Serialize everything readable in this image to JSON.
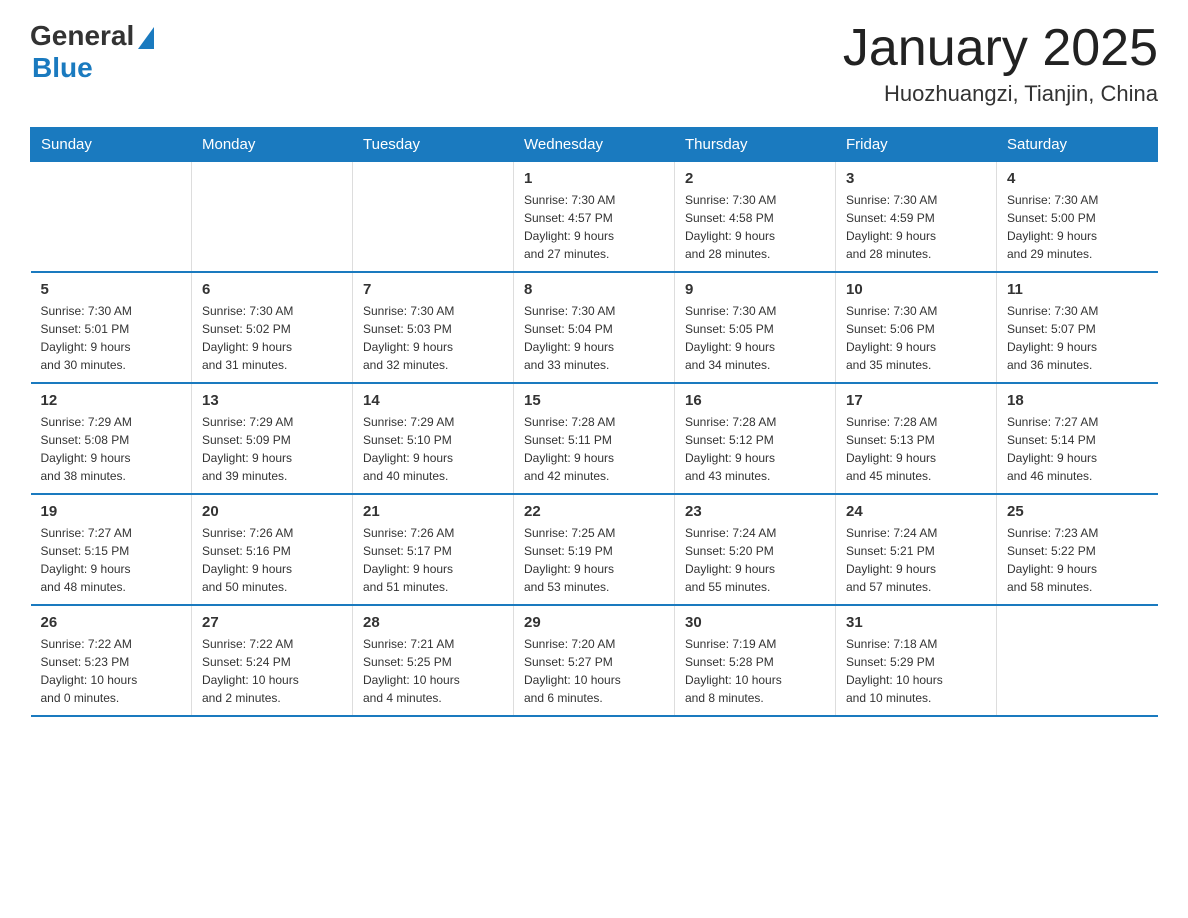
{
  "logo": {
    "general": "General",
    "blue": "Blue"
  },
  "title": "January 2025",
  "subtitle": "Huozhuangzi, Tianjin, China",
  "days_of_week": [
    "Sunday",
    "Monday",
    "Tuesday",
    "Wednesday",
    "Thursday",
    "Friday",
    "Saturday"
  ],
  "weeks": [
    [
      {
        "day": "",
        "info": ""
      },
      {
        "day": "",
        "info": ""
      },
      {
        "day": "",
        "info": ""
      },
      {
        "day": "1",
        "info": "Sunrise: 7:30 AM\nSunset: 4:57 PM\nDaylight: 9 hours\nand 27 minutes."
      },
      {
        "day": "2",
        "info": "Sunrise: 7:30 AM\nSunset: 4:58 PM\nDaylight: 9 hours\nand 28 minutes."
      },
      {
        "day": "3",
        "info": "Sunrise: 7:30 AM\nSunset: 4:59 PM\nDaylight: 9 hours\nand 28 minutes."
      },
      {
        "day": "4",
        "info": "Sunrise: 7:30 AM\nSunset: 5:00 PM\nDaylight: 9 hours\nand 29 minutes."
      }
    ],
    [
      {
        "day": "5",
        "info": "Sunrise: 7:30 AM\nSunset: 5:01 PM\nDaylight: 9 hours\nand 30 minutes."
      },
      {
        "day": "6",
        "info": "Sunrise: 7:30 AM\nSunset: 5:02 PM\nDaylight: 9 hours\nand 31 minutes."
      },
      {
        "day": "7",
        "info": "Sunrise: 7:30 AM\nSunset: 5:03 PM\nDaylight: 9 hours\nand 32 minutes."
      },
      {
        "day": "8",
        "info": "Sunrise: 7:30 AM\nSunset: 5:04 PM\nDaylight: 9 hours\nand 33 minutes."
      },
      {
        "day": "9",
        "info": "Sunrise: 7:30 AM\nSunset: 5:05 PM\nDaylight: 9 hours\nand 34 minutes."
      },
      {
        "day": "10",
        "info": "Sunrise: 7:30 AM\nSunset: 5:06 PM\nDaylight: 9 hours\nand 35 minutes."
      },
      {
        "day": "11",
        "info": "Sunrise: 7:30 AM\nSunset: 5:07 PM\nDaylight: 9 hours\nand 36 minutes."
      }
    ],
    [
      {
        "day": "12",
        "info": "Sunrise: 7:29 AM\nSunset: 5:08 PM\nDaylight: 9 hours\nand 38 minutes."
      },
      {
        "day": "13",
        "info": "Sunrise: 7:29 AM\nSunset: 5:09 PM\nDaylight: 9 hours\nand 39 minutes."
      },
      {
        "day": "14",
        "info": "Sunrise: 7:29 AM\nSunset: 5:10 PM\nDaylight: 9 hours\nand 40 minutes."
      },
      {
        "day": "15",
        "info": "Sunrise: 7:28 AM\nSunset: 5:11 PM\nDaylight: 9 hours\nand 42 minutes."
      },
      {
        "day": "16",
        "info": "Sunrise: 7:28 AM\nSunset: 5:12 PM\nDaylight: 9 hours\nand 43 minutes."
      },
      {
        "day": "17",
        "info": "Sunrise: 7:28 AM\nSunset: 5:13 PM\nDaylight: 9 hours\nand 45 minutes."
      },
      {
        "day": "18",
        "info": "Sunrise: 7:27 AM\nSunset: 5:14 PM\nDaylight: 9 hours\nand 46 minutes."
      }
    ],
    [
      {
        "day": "19",
        "info": "Sunrise: 7:27 AM\nSunset: 5:15 PM\nDaylight: 9 hours\nand 48 minutes."
      },
      {
        "day": "20",
        "info": "Sunrise: 7:26 AM\nSunset: 5:16 PM\nDaylight: 9 hours\nand 50 minutes."
      },
      {
        "day": "21",
        "info": "Sunrise: 7:26 AM\nSunset: 5:17 PM\nDaylight: 9 hours\nand 51 minutes."
      },
      {
        "day": "22",
        "info": "Sunrise: 7:25 AM\nSunset: 5:19 PM\nDaylight: 9 hours\nand 53 minutes."
      },
      {
        "day": "23",
        "info": "Sunrise: 7:24 AM\nSunset: 5:20 PM\nDaylight: 9 hours\nand 55 minutes."
      },
      {
        "day": "24",
        "info": "Sunrise: 7:24 AM\nSunset: 5:21 PM\nDaylight: 9 hours\nand 57 minutes."
      },
      {
        "day": "25",
        "info": "Sunrise: 7:23 AM\nSunset: 5:22 PM\nDaylight: 9 hours\nand 58 minutes."
      }
    ],
    [
      {
        "day": "26",
        "info": "Sunrise: 7:22 AM\nSunset: 5:23 PM\nDaylight: 10 hours\nand 0 minutes."
      },
      {
        "day": "27",
        "info": "Sunrise: 7:22 AM\nSunset: 5:24 PM\nDaylight: 10 hours\nand 2 minutes."
      },
      {
        "day": "28",
        "info": "Sunrise: 7:21 AM\nSunset: 5:25 PM\nDaylight: 10 hours\nand 4 minutes."
      },
      {
        "day": "29",
        "info": "Sunrise: 7:20 AM\nSunset: 5:27 PM\nDaylight: 10 hours\nand 6 minutes."
      },
      {
        "day": "30",
        "info": "Sunrise: 7:19 AM\nSunset: 5:28 PM\nDaylight: 10 hours\nand 8 minutes."
      },
      {
        "day": "31",
        "info": "Sunrise: 7:18 AM\nSunset: 5:29 PM\nDaylight: 10 hours\nand 10 minutes."
      },
      {
        "day": "",
        "info": ""
      }
    ]
  ]
}
